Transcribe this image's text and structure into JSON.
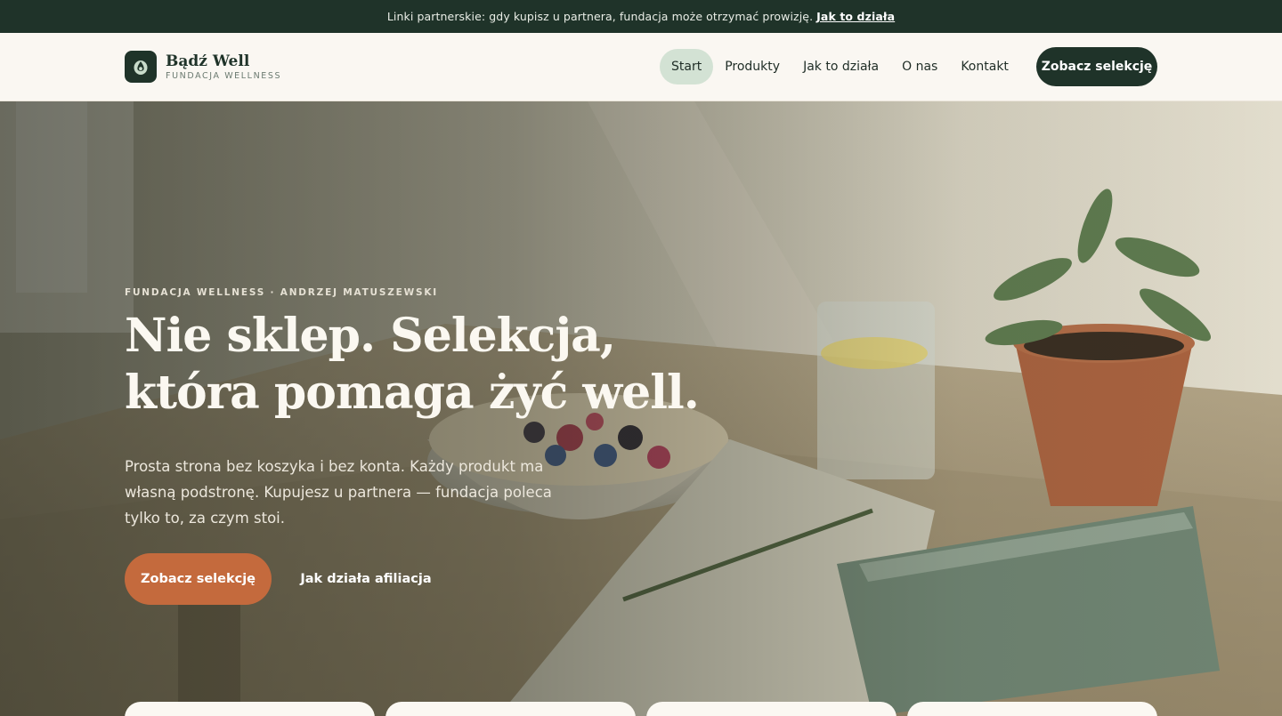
{
  "topbar": {
    "text": "Linki partnerskie: gdy kupisz u partnera, fundacja może otrzymać prowizję.",
    "link": "Jak to działa"
  },
  "brand": {
    "name": "Bądź Well",
    "tagline": "FUNDACJA WELLNESS",
    "logo_icon": "drop-icon"
  },
  "nav": {
    "items": [
      {
        "label": "Start",
        "active": true
      },
      {
        "label": "Produkty",
        "active": false
      },
      {
        "label": "Jak to działa",
        "active": false
      },
      {
        "label": "O nas",
        "active": false
      },
      {
        "label": "Kontakt",
        "active": false
      }
    ],
    "cta": "Zobacz selekcję"
  },
  "hero": {
    "eyebrow": "FUNDACJA WELLNESS · ANDRZEJ MATUSZEWSKI",
    "title_line1": "Nie sklep. Selekcja,",
    "title_line2": "która pomaga żyć well.",
    "lead": "Prosta strona bez koszyka i bez konta. Każdy produkt ma własną podstronę. Kupujesz u partnera — fundacja poleca tylko to, za czym stoi.",
    "primary_button": "Zobacz selekcję",
    "secondary_button": "Jak działa afiliacja"
  },
  "colors": {
    "dark_green": "#1f3329",
    "accent_orange": "#c46a3d",
    "active_nav": "#d3e2d4",
    "background": "#faf7f2"
  }
}
